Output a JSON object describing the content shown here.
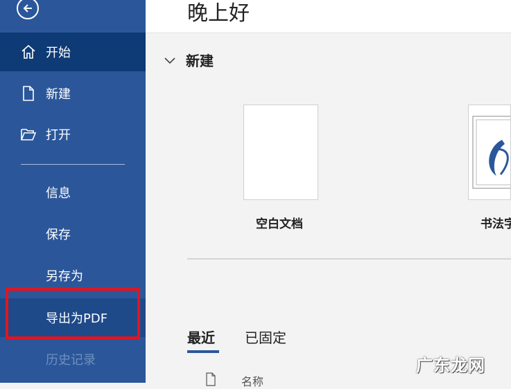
{
  "sidebar": {
    "items": [
      {
        "label": "开始",
        "icon": "home-icon"
      },
      {
        "label": "新建",
        "icon": "new-document-icon"
      },
      {
        "label": "打开",
        "icon": "folder-open-icon"
      },
      {
        "label": "信息"
      },
      {
        "label": "保存"
      },
      {
        "label": "另存为"
      },
      {
        "label": "导出为PDF"
      },
      {
        "label": "历史记录"
      }
    ],
    "colors": {
      "background": "#2b579a",
      "active": "#0e3a75",
      "highlight_border": "#e3141f"
    }
  },
  "main": {
    "greeting": "晚上好",
    "new_section": {
      "title": "新建",
      "templates": [
        {
          "label": "空白文档"
        },
        {
          "label": "书法字"
        }
      ]
    },
    "tabs": [
      {
        "label": "最近"
      },
      {
        "label": "已固定"
      }
    ],
    "list_header": {
      "name": "名称"
    }
  },
  "watermark": {
    "text": "广东龙网"
  }
}
